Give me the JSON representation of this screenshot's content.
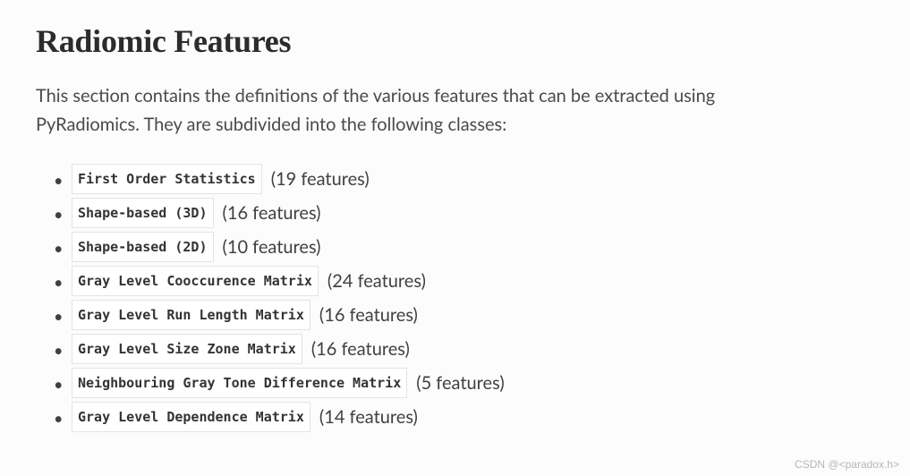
{
  "title": "Radiomic Features",
  "intro": "This section contains the definitions of the various features that can be extracted using PyRadiomics. They are subdivided into the following classes:",
  "features": [
    {
      "name": "First Order Statistics",
      "count": "(19 features)"
    },
    {
      "name": "Shape-based (3D)",
      "count": "(16 features)"
    },
    {
      "name": "Shape-based (2D)",
      "count": "(10 features)"
    },
    {
      "name": "Gray Level Cooccurence Matrix",
      "count": "(24 features)"
    },
    {
      "name": "Gray Level Run Length Matrix",
      "count": "(16 features)"
    },
    {
      "name": "Gray Level Size Zone Matrix",
      "count": "(16 features)"
    },
    {
      "name": "Neighbouring Gray Tone Difference Matrix",
      "count": "(5 features)"
    },
    {
      "name": "Gray Level Dependence Matrix",
      "count": "(14 features)"
    }
  ],
  "watermark": "CSDN @<paradox.h>"
}
